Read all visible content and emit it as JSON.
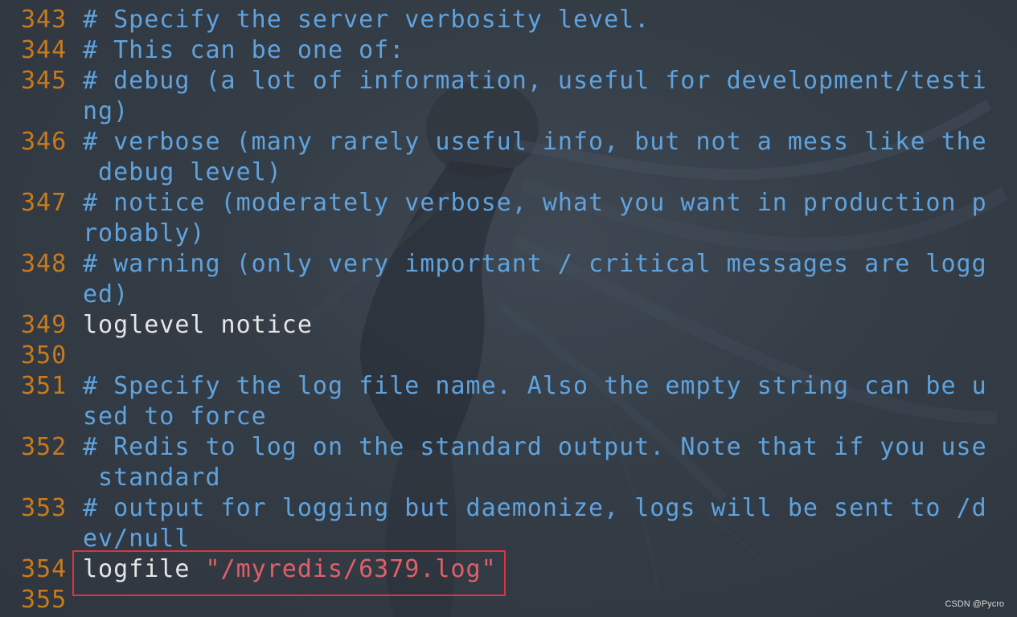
{
  "editor": {
    "lines": [
      {
        "num": "343",
        "text": "# Specify the server verbosity level.",
        "kind": "comment"
      },
      {
        "num": "344",
        "text": "# This can be one of:",
        "kind": "comment"
      },
      {
        "num": "345",
        "text": "# debug (a lot of information, useful for development/testi",
        "cont": "ng)",
        "kind": "comment"
      },
      {
        "num": "346",
        "text": "# verbose (many rarely useful info, but not a mess like the",
        "cont": " debug level)",
        "kind": "comment"
      },
      {
        "num": "347",
        "text": "# notice (moderately verbose, what you want in production p",
        "cont": "robably)",
        "kind": "comment"
      },
      {
        "num": "348",
        "text": "# warning (only very important / critical messages are logg",
        "cont": "ed)",
        "kind": "comment"
      },
      {
        "num": "349",
        "text": "loglevel notice",
        "kind": "plain"
      },
      {
        "num": "350",
        "text": "",
        "kind": "plain"
      },
      {
        "num": "351",
        "text": "# Specify the log file name. Also the empty string can be u",
        "cont": "sed to force",
        "kind": "comment"
      },
      {
        "num": "352",
        "text": "# Redis to log on the standard output. Note that if you use",
        "cont": " standard",
        "kind": "comment"
      },
      {
        "num": "353",
        "text": "# output for logging but daemonize, logs will be sent to /d",
        "cont": "ev/null",
        "kind": "comment"
      },
      {
        "num": "354",
        "key": "logfile ",
        "value": "\"/myredis/6379.log\"",
        "kind": "setting"
      },
      {
        "num": "355",
        "text": "",
        "kind": "plain"
      }
    ]
  },
  "watermark": "CSDN @Pycro",
  "colors": {
    "background": "#333b44",
    "line_number": "#c87a1c",
    "comment": "#5fa3de",
    "plain": "#e6e6e6",
    "string": "#e0606a",
    "highlight_border": "#e0333f"
  }
}
